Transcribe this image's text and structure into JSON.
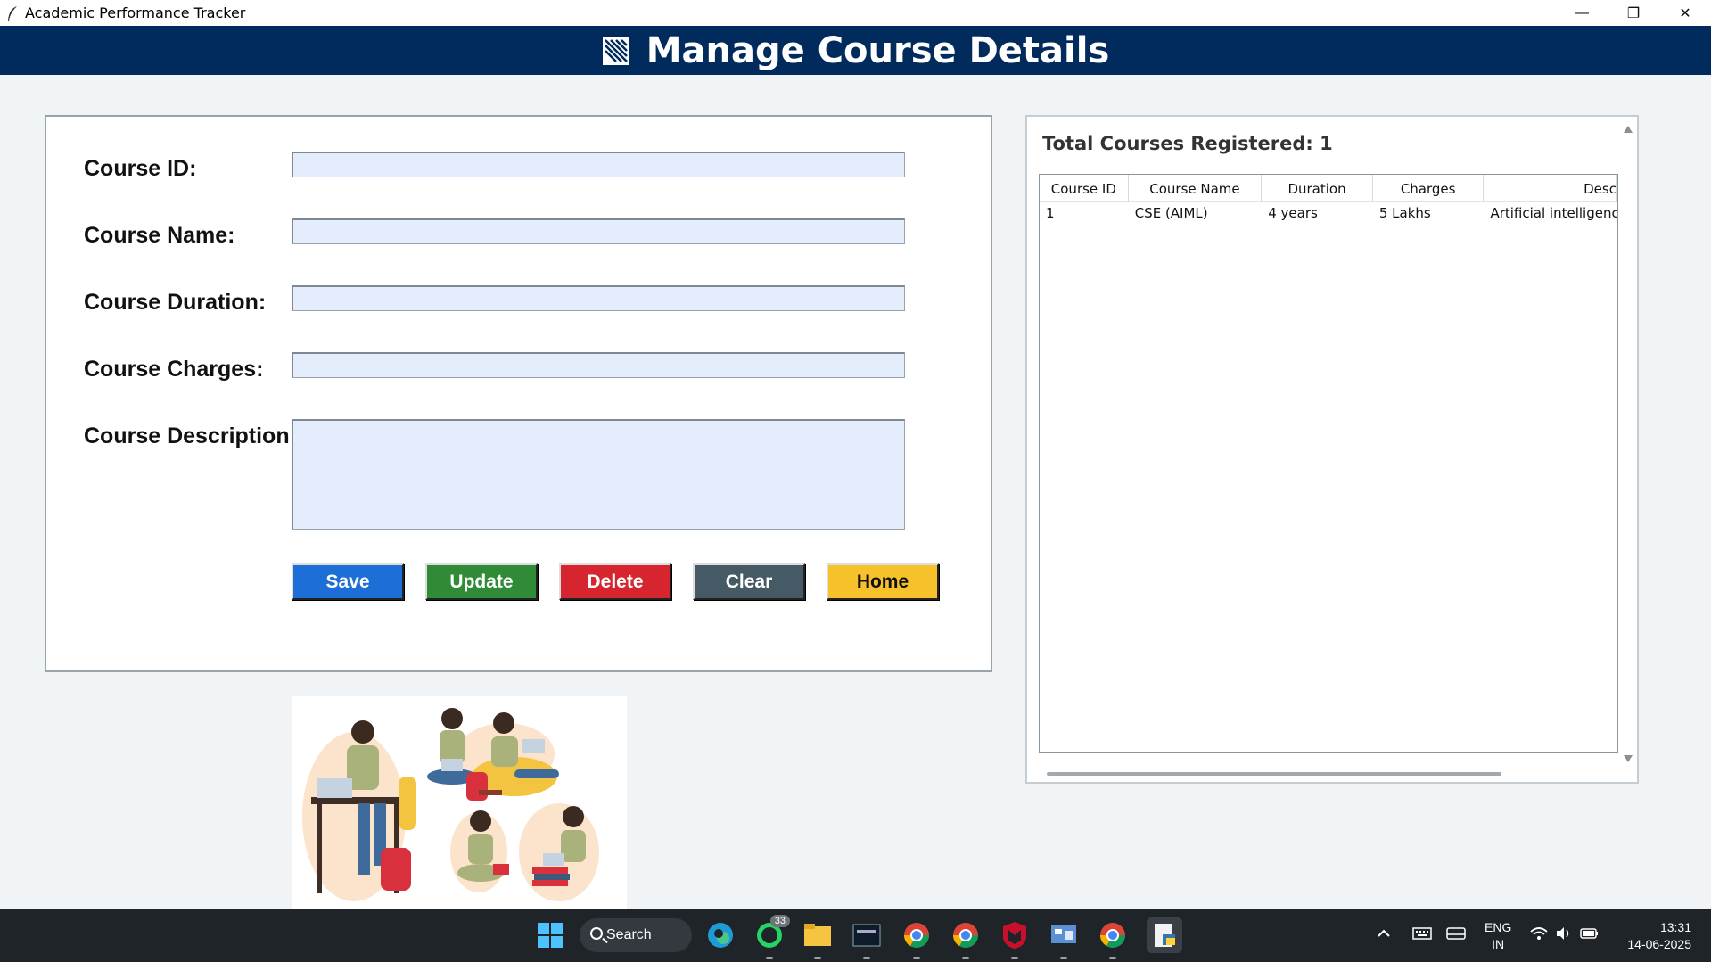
{
  "window": {
    "title": "Academic Performance Tracker",
    "minimize": "—",
    "restore": "❐",
    "close": "✕"
  },
  "header": {
    "title": "Manage Course Details",
    "bg_color": "#002b5c"
  },
  "form": {
    "course_id_label": "Course ID:",
    "course_id_value": "",
    "course_name_label": "Course Name:",
    "course_name_value": "",
    "course_duration_label": "Course Duration:",
    "course_duration_value": "",
    "course_charges_label": "Course Charges:",
    "course_charges_value": "",
    "course_description_label": "Course Description:",
    "course_description_value": ""
  },
  "buttons": {
    "save": "Save",
    "update": "Update",
    "delete": "Delete",
    "clear": "Clear",
    "home": "Home"
  },
  "colors": {
    "save": "#1c6fd6",
    "update": "#2f8b36",
    "delete": "#d6252f",
    "clear": "#455a64",
    "home": "#f7c12b",
    "input_bg": "#e3edfb"
  },
  "list": {
    "total_label": "Total Courses Registered: 1",
    "columns": [
      "Course ID",
      "Course Name",
      "Duration",
      "Charges",
      "Desc"
    ],
    "rows": [
      [
        "1",
        "CSE (AIML)",
        "4 years",
        "5 Lakhs",
        "Artificial intelligence a"
      ]
    ]
  },
  "taskbar": {
    "search_label": "Search",
    "whatsapp_badge": "33",
    "lang_line1": "ENG",
    "lang_line2": "IN",
    "time": "13:31",
    "date": "14-06-2025",
    "icons": [
      "windows-start-icon",
      "search-icon",
      "edge-icon",
      "whatsapp-icon",
      "file-explorer-icon",
      "mysql-icon",
      "chrome-icon",
      "chrome-profile-icon",
      "mcafee-icon",
      "control-panel-icon",
      "chrome-alt-icon",
      "python-idle-icon"
    ]
  }
}
